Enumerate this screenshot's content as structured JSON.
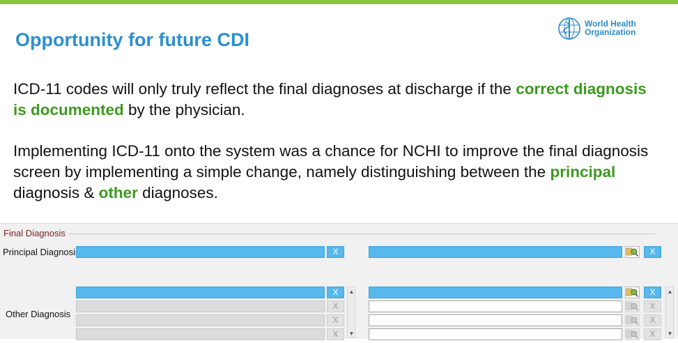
{
  "slide": {
    "title": "Opportunity for future CDI",
    "logo": {
      "line1": "World Health",
      "line2": "Organization"
    },
    "p1": {
      "a": "ICD-11 codes will only truly reflect the final diagnoses at discharge if the ",
      "b": "correct diagnosis is documented",
      "c": " by the physician."
    },
    "p2": {
      "a": "Implementing ICD-11 onto the system was a chance for NCHI to improve the final diagnosis screen by implementing a simple change, namely distinguishing between the ",
      "b": "principal",
      "c": " diagnosis & ",
      "d": "other",
      "e": " diagnoses."
    }
  },
  "form": {
    "legend": "Final Diagnosis",
    "principal_label": "Principal Diagnosis",
    "other_label": "Other Diagnosis",
    "clear_label": "X"
  },
  "colors": {
    "accent_green": "#3c9a1e",
    "title_blue": "#2b8fd0",
    "field_blue": "#56b8ec",
    "top_bar": "#8cc63f"
  }
}
